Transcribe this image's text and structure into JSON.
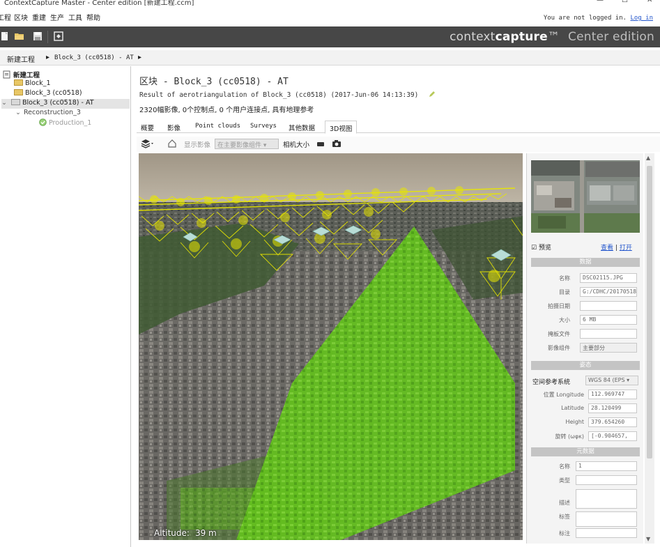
{
  "window": {
    "title": "ContextCapture Master - Center edition [新建工程.ccm]",
    "minimize": "—",
    "maximize": "☐",
    "close": "✕"
  },
  "menu": {
    "items": [
      "工程",
      "区块",
      "重建",
      "生产",
      "工具",
      "帮助"
    ],
    "login_text": "You are not logged in.",
    "login_link": "Log in"
  },
  "brand": {
    "part1": "context",
    "part2": "capture",
    "tm": "™",
    "edition": "Center edition"
  },
  "breadcrumb": {
    "root": "新建工程",
    "sep": "▸",
    "current": "Block_3 (cc0518) - AT"
  },
  "tree": {
    "root": "新建工程",
    "items": [
      {
        "label": "Block_1"
      },
      {
        "label": "Block_3 (cc0518)"
      },
      {
        "label": "Block_3 (cc0518) - AT"
      },
      {
        "label": "Reconstruction_3"
      },
      {
        "label": "Production_1"
      }
    ]
  },
  "header": {
    "title": "区块 - Block_3 (cc0518) - AT",
    "subtitle": "Result of aerotriangulation of Block_3 (cc0518) (2017-Jun-06 14:13:39)",
    "summary": "2320幅影像, 0个控制点, 0 个用户连接点, 具有地理参考"
  },
  "tabs": [
    "概要",
    "影像",
    "Point clouds",
    "Surveys",
    "其他数据",
    "3D视图"
  ],
  "active_tab": "3D视图",
  "viewer_toolbar": {
    "show_images": "显示影像",
    "combo_value": "在主要影像组件",
    "camera_size": "相机大小"
  },
  "viewport": {
    "altitude_label": "Altitude:",
    "altitude_value": "39 m"
  },
  "panel": {
    "preview_check": "预览",
    "link_view": "查看",
    "link_sep": "|",
    "link_open": "打开",
    "sec_data": "数据",
    "data_rows": [
      {
        "label": "名称",
        "value": "DSC02115.JPG"
      },
      {
        "label": "目录",
        "value": "G:/CDHC/20170518"
      },
      {
        "label": "拍摄日期",
        "value": ""
      },
      {
        "label": "大小",
        "value": "6 MB"
      },
      {
        "label": "掩板文件",
        "value": ""
      },
      {
        "label": "影像组件",
        "value": "主要部分"
      }
    ],
    "sec_pose": "姿态",
    "srs_label": "空间参考系统",
    "srs_value": "WGS 84 (EPS ▾",
    "pose_rows": [
      {
        "label": "位置 Longitude",
        "value": "112.969747"
      },
      {
        "label": "Latitude",
        "value": "28.120499"
      },
      {
        "label": "Height",
        "value": "379.654260"
      },
      {
        "label": "旋转 (ωφκ)",
        "value": "[-0.904657,"
      }
    ],
    "sec_meta": "元数据",
    "meta_rows": [
      {
        "label": "名称",
        "value": "1"
      },
      {
        "label": "类型",
        "value": ""
      },
      {
        "label": "描述",
        "value": ""
      },
      {
        "label": "标签",
        "value": ""
      },
      {
        "label": "标注",
        "value": ""
      }
    ]
  },
  "colors": {
    "toolbar_bg": "#474747",
    "link": "#2255cc",
    "camera_yellow": "#e8e600",
    "selection_green": "#69c61f"
  },
  "icons": [
    "new-icon",
    "open-icon",
    "save-icon",
    "settings-icon",
    "layers-icon",
    "home-icon",
    "camera-icon",
    "edit-pencil-icon"
  ]
}
